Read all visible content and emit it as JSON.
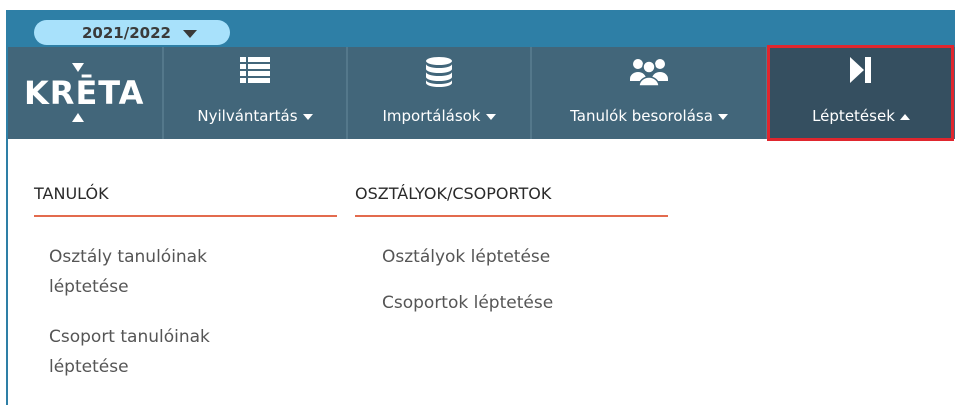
{
  "year_selector": {
    "value": "2021/2022"
  },
  "logo": {
    "text": "KRĒTA"
  },
  "nav": {
    "items": [
      {
        "label": "Nyilvántartás",
        "icon": "list-icon"
      },
      {
        "label": "Importálások",
        "icon": "database-icon"
      },
      {
        "label": "Tanulók besorolása",
        "icon": "users-icon"
      },
      {
        "label": "Léptetések",
        "icon": "step-forward-icon"
      }
    ]
  },
  "dropdown": {
    "columns": [
      {
        "heading": "TANULÓK",
        "links": [
          {
            "line1": "Osztály tanulóinak",
            "line2": "léptetése"
          },
          {
            "line1": "Csoport tanulóinak",
            "line2": "léptetése"
          }
        ]
      },
      {
        "heading": "OSZTÁLYOK/CSOPORTOK",
        "links": [
          {
            "line1": "Osztályok léptetése"
          },
          {
            "line1": "Csoportok léptetése"
          }
        ]
      }
    ]
  },
  "colors": {
    "topbar": "#2e7fa6",
    "navbar": "#42667a",
    "active_nav": "#354f60",
    "highlight_box": "#e0262e",
    "heading_underline": "#e36b4e",
    "year_pill": "#a8e1fb"
  }
}
